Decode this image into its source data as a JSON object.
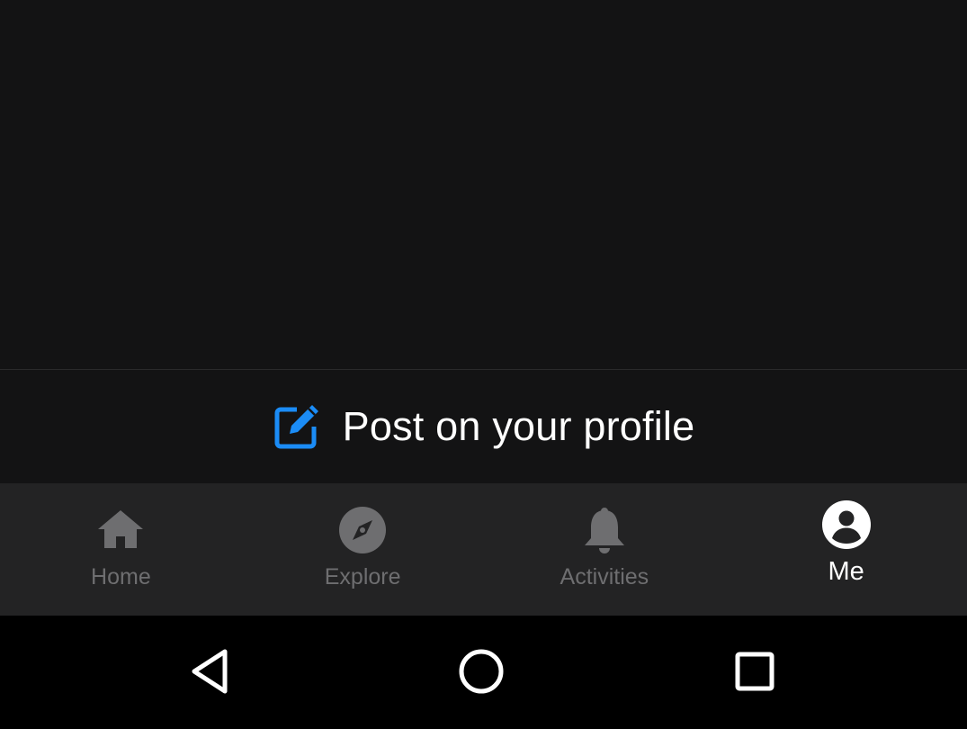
{
  "post_bar": {
    "label": "Post on your profile",
    "icon": "edit-square-icon",
    "accent_color": "#1b8cf6"
  },
  "bottom_nav": {
    "items": [
      {
        "label": "Home",
        "icon": "home-icon",
        "active": false
      },
      {
        "label": "Explore",
        "icon": "compass-icon",
        "active": false
      },
      {
        "label": "Activities",
        "icon": "bell-icon",
        "active": false
      },
      {
        "label": "Me",
        "icon": "account-circle-icon",
        "active": true
      }
    ],
    "inactive_color": "#6e6e70",
    "active_color": "#ffffff"
  },
  "system_nav": {
    "buttons": [
      {
        "icon": "back-triangle-icon"
      },
      {
        "icon": "home-circle-icon"
      },
      {
        "icon": "recents-square-icon"
      }
    ]
  }
}
